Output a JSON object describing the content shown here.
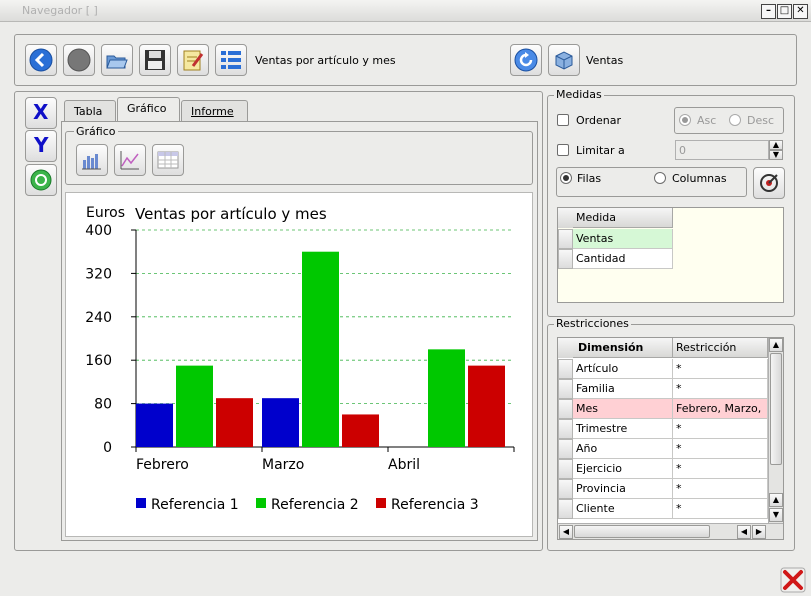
{
  "window": {
    "title": "Navegador [ ]",
    "minimize": "–",
    "maximize": "□",
    "close": "✕"
  },
  "toolbar": {
    "report_title": "Ventas por artículo y mes",
    "cube_label": "Ventas"
  },
  "axis_buttons": {
    "x": "X",
    "y": "Y"
  },
  "tabs": [
    {
      "label": "Tabla"
    },
    {
      "label": "Gráfico"
    },
    {
      "label": "Informe"
    }
  ],
  "grafico_group": {
    "title": "Gráfico"
  },
  "chart_data": {
    "type": "bar",
    "title": "Ventas por artículo y mes",
    "ylabel": "Euros",
    "categories": [
      "Febrero",
      "Marzo",
      "Abril"
    ],
    "ylim": [
      0,
      400
    ],
    "yticks": [
      0,
      80,
      160,
      240,
      320,
      400
    ],
    "grid": true,
    "legend": "bottom",
    "series": [
      {
        "name": "Referencia 1",
        "color": "#0000cc",
        "values": [
          80,
          90,
          0
        ]
      },
      {
        "name": "Referencia 2",
        "color": "#00c800",
        "values": [
          150,
          360,
          180
        ]
      },
      {
        "name": "Referencia 3",
        "color": "#cc0000",
        "values": [
          90,
          60,
          150
        ]
      }
    ]
  },
  "medidas": {
    "title": "Medidas",
    "ordenar_label": "Ordenar",
    "asc_label": "Asc",
    "desc_label": "Desc",
    "limitar_label": "Limitar a",
    "limit_value": "0",
    "filas_label": "Filas",
    "columnas_label": "Columnas",
    "table_header": "Medida",
    "rows": [
      {
        "label": "Ventas",
        "selected": true
      },
      {
        "label": "Cantidad",
        "selected": false
      }
    ]
  },
  "restricciones": {
    "title": "Restricciones",
    "headers": [
      "Dimensión",
      "Restricción"
    ],
    "rows": [
      {
        "dim": "Artículo",
        "rest": "*",
        "highlight": false
      },
      {
        "dim": "Familia",
        "rest": "*",
        "highlight": false
      },
      {
        "dim": "Mes",
        "rest": "Febrero, Marzo,",
        "highlight": true
      },
      {
        "dim": "Trimestre",
        "rest": "*",
        "highlight": false
      },
      {
        "dim": "Año",
        "rest": "*",
        "highlight": false
      },
      {
        "dim": "Ejercicio",
        "rest": "*",
        "highlight": false
      },
      {
        "dim": "Provincia",
        "rest": "*",
        "highlight": false
      },
      {
        "dim": "Cliente",
        "rest": "*",
        "highlight": false
      }
    ]
  }
}
